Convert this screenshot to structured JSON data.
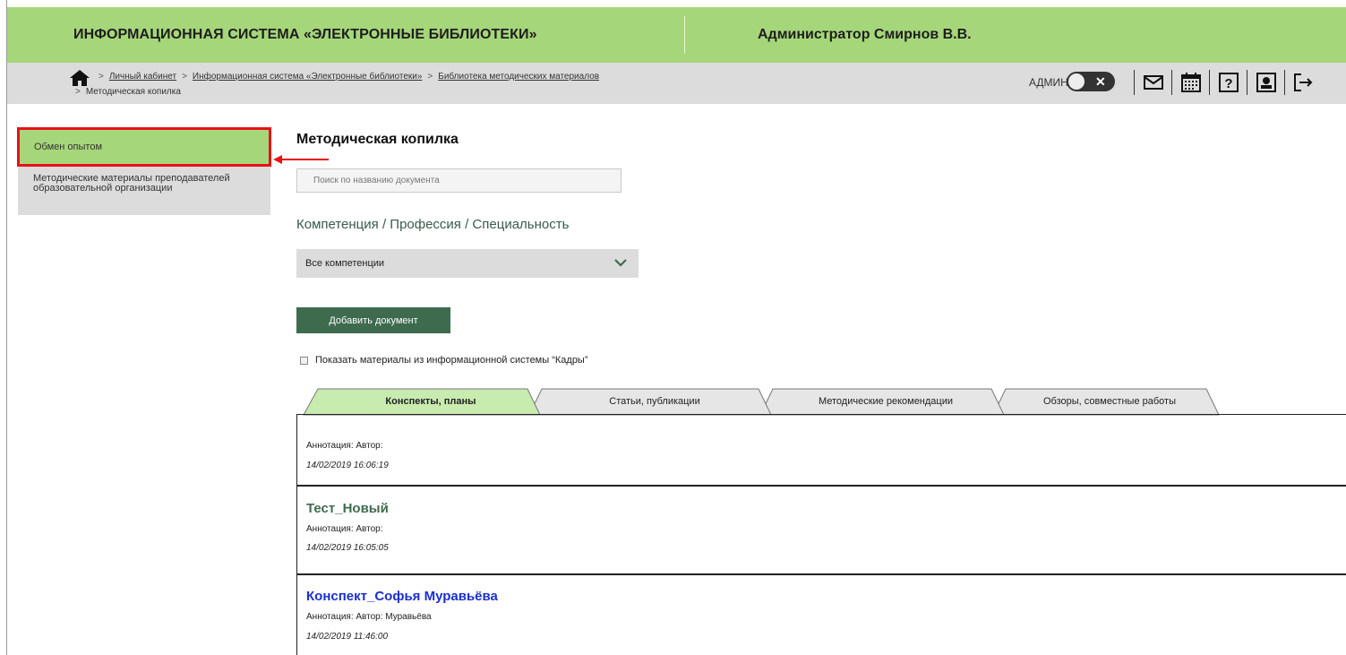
{
  "header": {
    "system_title": "ИНФОРМАЦИОННАЯ СИСТЕМА «ЭЛЕКТРОННЫЕ БИБЛИОТЕКИ»",
    "user": "Администратор Смирнов В.В."
  },
  "breadcrumb": {
    "items": [
      "Личный кабинет",
      "Информационная система «Электронные библиотеки»",
      "Библиотека методических материалов"
    ],
    "current": "Методическая копилка"
  },
  "toolbar": {
    "admin_label": "АДМИН",
    "toggle_mark": "✕",
    "icons": [
      "mail-icon",
      "calendar-icon",
      "help-icon",
      "profile-icon",
      "logout-icon"
    ]
  },
  "sidebar": {
    "items": [
      {
        "label": "Обмен опытом",
        "active": true
      },
      {
        "label": "Методические материалы преподавателей образовательной организации",
        "active": false
      }
    ]
  },
  "main": {
    "title": "Методическая копилка",
    "search_placeholder": "Поиск по названию документа",
    "filter_label": "Компетенция / Профессия / Специальность",
    "select_value": "Все компетенции",
    "add_button": "Добавить документ",
    "checkbox_label": "Показать материалы из информационной системы “Кадры”",
    "tabs": [
      {
        "label": "Конспекты, планы",
        "active": true
      },
      {
        "label": "Статьи, публикации",
        "active": false
      },
      {
        "label": "Методические рекомендации",
        "active": false
      },
      {
        "label": "Обзоры, совместные работы",
        "active": false
      }
    ],
    "entries": [
      {
        "title": "",
        "meta": "Аннотация:  Автор:",
        "date": "14/02/2019 16:06:19"
      },
      {
        "title": "Тест_Новый",
        "meta": "Аннотация:  Автор:",
        "date": "14/02/2019 16:05:05",
        "color": "#3e6b4e"
      },
      {
        "title": "Конспект_Софья Муравьёва",
        "meta": "Аннотация:  Автор:  Муравьёва",
        "date": "14/02/2019 11:46:00",
        "color": "#1a2fcf"
      }
    ]
  },
  "colors": {
    "header_green": "#a6d67a",
    "button_green": "#3e6b4e",
    "highlight_red": "#e8101a",
    "link_blue": "#1a2fcf"
  }
}
